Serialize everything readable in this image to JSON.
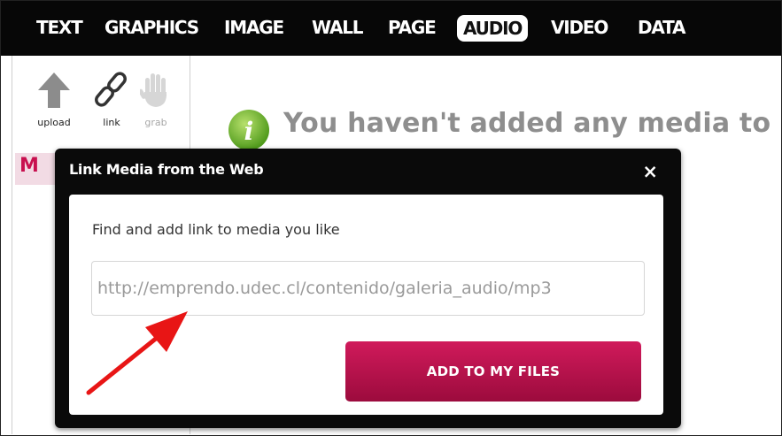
{
  "nav": {
    "items": [
      {
        "label": "TEXT"
      },
      {
        "label": "GRAPHICS"
      },
      {
        "label": "IMAGE"
      },
      {
        "label": "WALL"
      },
      {
        "label": "PAGE"
      },
      {
        "label": "AUDIO"
      },
      {
        "label": "VIDEO"
      },
      {
        "label": "DATA"
      }
    ]
  },
  "sidebar": {
    "tools": [
      {
        "label": "upload",
        "icon": "upload-arrow-icon"
      },
      {
        "label": "link",
        "icon": "chain-link-icon"
      },
      {
        "label": "grab",
        "icon": "hand-grab-icon"
      }
    ],
    "tab_letter": "M"
  },
  "main": {
    "empty_message": "You haven't added any media to"
  },
  "modal": {
    "title": "Link Media from the Web",
    "close": "×",
    "instruction": "Find and add link to media you like",
    "url_value": "http://emprendo.udec.cl/contenido/galeria_audio/mp3",
    "add_button": "ADD TO MY FILES"
  },
  "colors": {
    "accent": "#c8104f",
    "nav_bg": "#070707",
    "arrow": "#e81515"
  }
}
